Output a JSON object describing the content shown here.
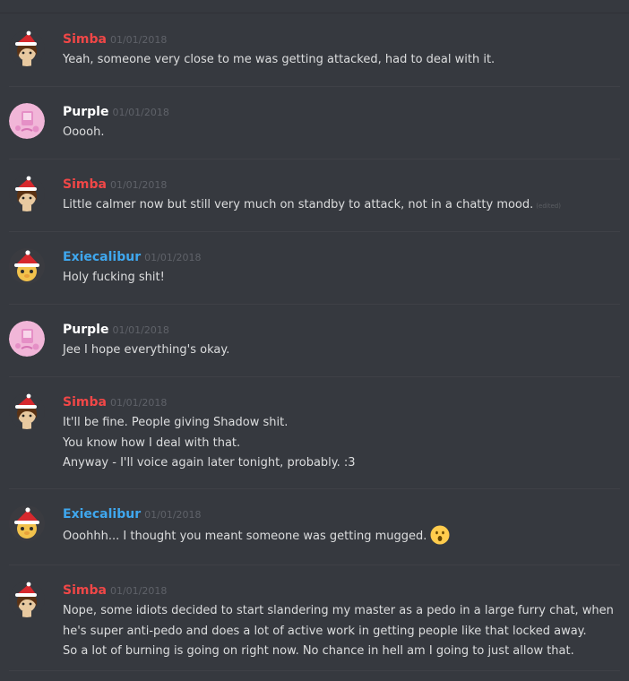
{
  "colors": {
    "background": "#36393f",
    "divider": "#3f4147",
    "timestamp": "#5f6269",
    "text": "#dcddde"
  },
  "messages": [
    {
      "author": "Simba",
      "author_color": "#f04747",
      "avatar": "simba-avatar",
      "timestamp": "01/01/2018",
      "lines": [
        "Yeah, someone very close to me was getting attacked, had to deal with it."
      ]
    },
    {
      "author": "Purple",
      "author_color": "#ffffff",
      "avatar": "purple-avatar",
      "timestamp": "01/01/2018",
      "lines": [
        "Ooooh."
      ]
    },
    {
      "author": "Simba",
      "author_color": "#f04747",
      "avatar": "simba-avatar",
      "timestamp": "01/01/2018",
      "lines": [
        "Little calmer now but still very much on standby to attack, not in a chatty mood."
      ],
      "edited": "(edited)"
    },
    {
      "author": "Exiecalibur",
      "author_color": "#3fa7ee",
      "avatar": "exiecalibur-avatar",
      "timestamp": "01/01/2018",
      "lines": [
        "Holy fucking shit!"
      ]
    },
    {
      "author": "Purple",
      "author_color": "#ffffff",
      "avatar": "purple-avatar",
      "timestamp": "01/01/2018",
      "lines": [
        "Jee I hope everything's okay."
      ]
    },
    {
      "author": "Simba",
      "author_color": "#f04747",
      "avatar": "simba-avatar",
      "timestamp": "01/01/2018",
      "lines": [
        "It'll be fine. People giving Shadow shit.",
        "You know how I deal with that.",
        "Anyway - I'll voice again later tonight, probably. :3"
      ]
    },
    {
      "author": "Exiecalibur",
      "author_color": "#3fa7ee",
      "avatar": "exiecalibur-avatar",
      "timestamp": "01/01/2018",
      "lines": [
        "Ooohhh... I thought you meant someone was getting mugged."
      ],
      "emoji": "hushed-face-emoji"
    },
    {
      "author": "Simba",
      "author_color": "#f04747",
      "avatar": "simba-avatar",
      "timestamp": "01/01/2018",
      "lines": [
        "Nope, some idiots decided to start slandering my master as a pedo in a large furry chat, when",
        "he's super anti-pedo and does a lot of active work in getting people like that locked away.",
        "So a lot of burning is going on right now. No chance in hell am I going to just allow that."
      ]
    }
  ]
}
